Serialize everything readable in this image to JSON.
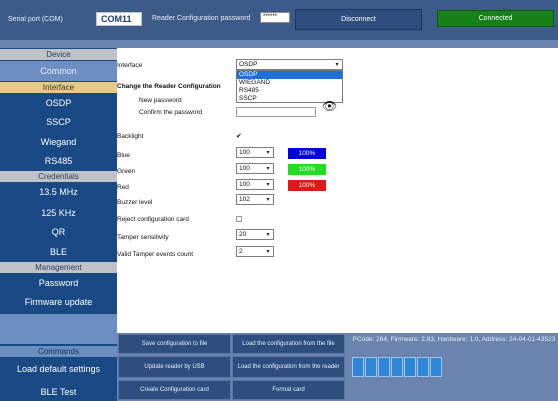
{
  "topbar": {
    "serial_label": "Serial port (COM)",
    "com_value": "COM11",
    "pwd_label": "Reader Configuration password",
    "pwd_value": "******",
    "disconnect_label": "Disconnect",
    "status_label": "Connected",
    "status_color": "#188018"
  },
  "sidebar": {
    "categories": [
      "Device",
      "Interface",
      "Credentials",
      "Management",
      "Commands"
    ],
    "items": {
      "common": "Common",
      "osdp": "OSDP",
      "sscp": "SSCP",
      "wiegand": "Wiegand",
      "rs485": "RS485",
      "mhz": "13.5 MHz",
      "khz": "125 KHz",
      "qr": "QR",
      "ble": "BLE",
      "password": "Password",
      "firmware": "Firmware update",
      "load_default": "Load default settings",
      "ble_test": "BLE Test"
    }
  },
  "form": {
    "interface_label": "Interface",
    "interface_value": "OSDP",
    "interface_options": [
      "OSDP",
      "WIEGAND",
      "RS485",
      "SSCP"
    ],
    "interface_highlighted": "OSDP",
    "change_config_heading": "Change the Reader Configuration",
    "new_password_label": "New password",
    "confirm_password_label": "Confirm the password",
    "backlight_label": "Backlight",
    "backlight_checked": true,
    "blue_label": "Blue",
    "blue_value": "100",
    "blue_percent": "100%",
    "blue_color": "#0000e0",
    "green_label": "Green",
    "green_value": "100",
    "green_percent": "100%",
    "green_color": "#22dd22",
    "red_label": "Red",
    "red_value": "100",
    "red_percent": "100%",
    "red_color": "#e01818",
    "buzzer_label": "Buzzer level",
    "buzzer_value": "102",
    "reject_label": "Reject configuration card",
    "reject_checked": false,
    "tamper_label": "Tamper sensitivity",
    "tamper_value": "20",
    "tamper_events_label": "Valid Tamper events count",
    "tamper_events_value": "2",
    "checkmark": "✔",
    "arrow": "▾",
    "eye": "👁"
  },
  "bottom": {
    "save_file": "Save configuration to file",
    "load_file": "Load the configuration from the file",
    "update_usb": "Update reader by USB",
    "load_reader": "Load the configuration from the reader",
    "create_card": "Create Configuration card",
    "format_card": "Format card",
    "device_info": "PCode: 264, Firmware: 2.83, Hardware: 1.0, Address: 24-04-01-43523",
    "led_color": "#2e86d6"
  }
}
